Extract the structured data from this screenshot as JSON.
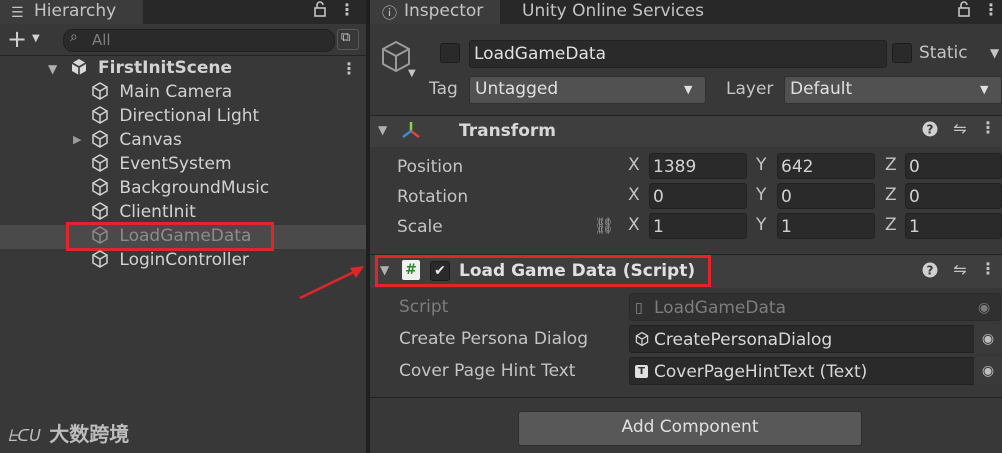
{
  "hierarchy": {
    "tab_label": "Hierarchy",
    "search_placeholder": "All",
    "scene_name": "FirstInitScene",
    "items": [
      {
        "label": "Main Camera"
      },
      {
        "label": "Directional Light"
      },
      {
        "label": "Canvas"
      },
      {
        "label": "EventSystem"
      },
      {
        "label": "BackgroundMusic"
      },
      {
        "label": "ClientInit"
      },
      {
        "label": "LoadGameData"
      },
      {
        "label": "LoginController"
      }
    ]
  },
  "inspector": {
    "tab_label": "Inspector",
    "services_tab_label": "Unity Online Services",
    "object_name": "LoadGameData",
    "static_label": "Static",
    "tag_label": "Tag",
    "tag_value": "Untagged",
    "layer_label": "Layer",
    "layer_value": "Default",
    "transform": {
      "title": "Transform",
      "position_label": "Position",
      "rotation_label": "Rotation",
      "scale_label": "Scale",
      "position": {
        "x": "1389",
        "y": "642",
        "z": "0"
      },
      "rotation": {
        "x": "0",
        "y": "0",
        "z": "0"
      },
      "scale": {
        "x": "1",
        "y": "1",
        "z": "1"
      },
      "axis_x": "X",
      "axis_y": "Y",
      "axis_z": "Z"
    },
    "script_component": {
      "title": "Load Game Data (Script)",
      "script_label": "Script",
      "script_value": "LoadGameData",
      "create_persona_label": "Create Persona Dialog",
      "create_persona_value": "CreatePersonaDialog",
      "cover_hint_label": "Cover Page Hint Text",
      "cover_hint_value": "CoverPageHintText (Text)"
    },
    "add_component_label": "Add Component"
  },
  "watermark": "大数跨境",
  "colors": {
    "highlight_red": "#e0262a",
    "panel_bg": "#383838",
    "tab_bg": "#282828"
  }
}
